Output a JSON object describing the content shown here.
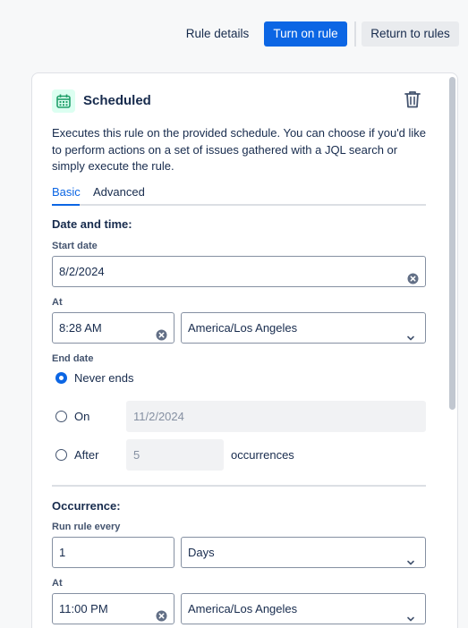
{
  "topbar": {
    "rule_details": "Rule details",
    "turn_on": "Turn on rule",
    "return": "Return to rules"
  },
  "trigger": {
    "title": "Scheduled",
    "description": "Executes this rule on the provided schedule. You can choose if you'd like to perform actions on a set of issues gathered with a JQL search or simply execute the rule.",
    "tabs": [
      "Basic",
      "Advanced"
    ],
    "active_tab": "Basic"
  },
  "date_time": {
    "section_title": "Date and time:",
    "start_date_label": "Start date",
    "start_date": "8/2/2024",
    "at_label": "At",
    "time": "8:28 AM",
    "timezone": "America/Los Angeles"
  },
  "end_date": {
    "label": "End date",
    "selected": "Never ends",
    "options": {
      "never": "Never ends",
      "on": "On",
      "after": "After"
    },
    "on_date": "11/2/2024",
    "after_count": "5",
    "occurrences_label": "occurrences"
  },
  "occurrence": {
    "section_title": "Occurrence:",
    "run_every_label": "Run rule every",
    "run_every_value": "1",
    "unit": "Days",
    "at_label": "At",
    "time": "11:00 PM",
    "timezone": "America/Los Angeles"
  },
  "colors": {
    "primary": "#0c66e4",
    "icon_green": "#22a06b",
    "icon_green_bg": "#dcfff1"
  }
}
